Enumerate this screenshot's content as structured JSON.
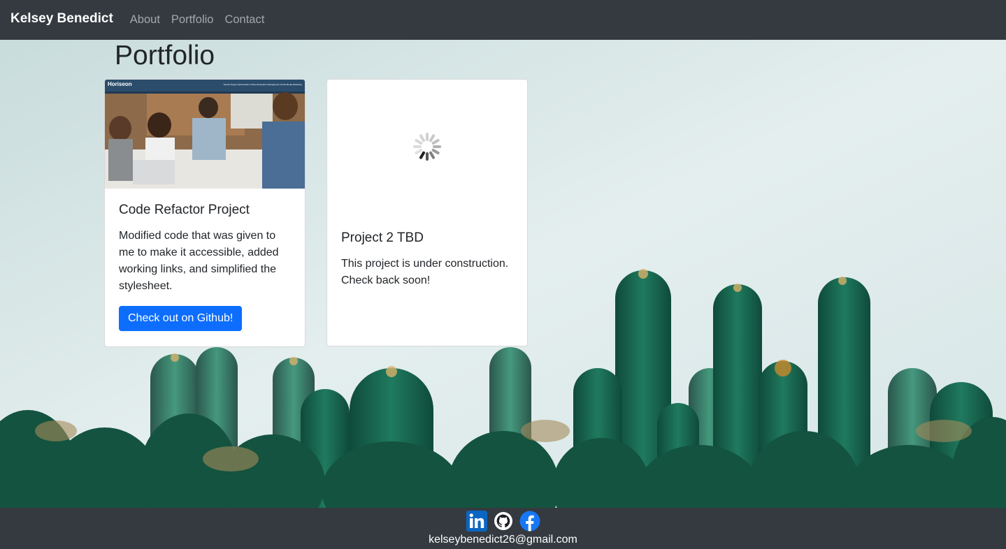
{
  "navbar": {
    "brand": "Kelsey Benedict",
    "links": [
      "About",
      "Portfolio",
      "Contact"
    ]
  },
  "page": {
    "title": "Portfolio"
  },
  "cards": [
    {
      "image_header": "Horiseon",
      "image_nav": "Search Engine Optimization  Online Reputation Management  Social Media Marketing",
      "title": "Code Refactor Project",
      "text": "Modified code that was given to me to make it accessible, added working links, and simplified the stylesheet.",
      "button": "Check out on Github!"
    },
    {
      "title": "Project 2 TBD",
      "text": "This project is under construction. Check back soon!",
      "spinner_icon": "loading-spinner-icon"
    }
  ],
  "footer": {
    "icons": [
      "linkedin-icon",
      "github-icon",
      "facebook-icon"
    ],
    "email": "kelseybenedict26@gmail.com"
  },
  "colors": {
    "navbar_bg": "#343a40",
    "primary_button": "#0d6efd",
    "linkedin": "#0a66c2",
    "facebook": "#1877f2"
  }
}
